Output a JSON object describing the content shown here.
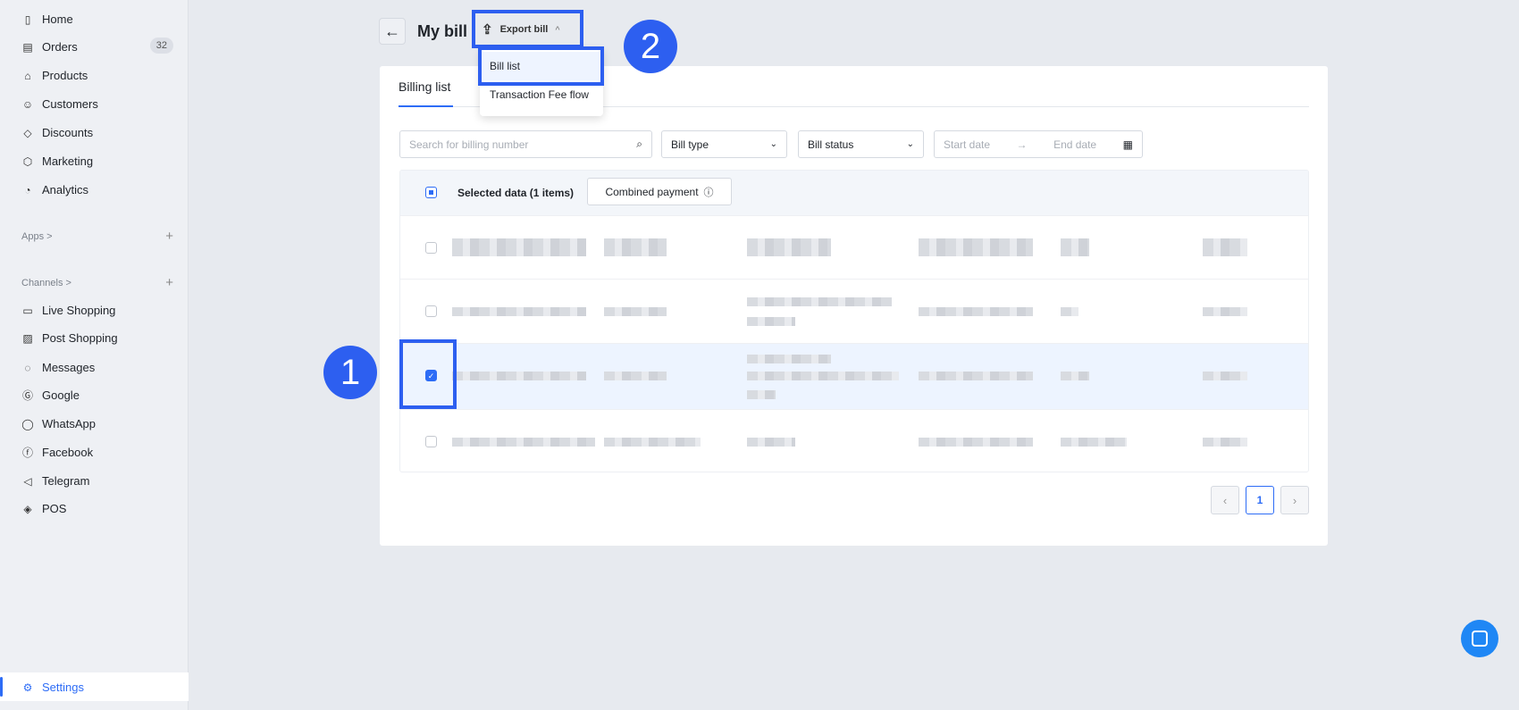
{
  "sidebar": {
    "items": [
      {
        "label": "Home",
        "icon": "home-icon"
      },
      {
        "label": "Orders",
        "icon": "orders-icon",
        "badge": "32"
      },
      {
        "label": "Products",
        "icon": "products-icon"
      },
      {
        "label": "Customers",
        "icon": "customers-icon"
      },
      {
        "label": "Discounts",
        "icon": "discounts-icon"
      },
      {
        "label": "Marketing",
        "icon": "marketing-icon"
      },
      {
        "label": "Analytics",
        "icon": "analytics-icon"
      }
    ],
    "apps_label": "Apps >",
    "channels_label": "Channels >",
    "channels": [
      {
        "label": "Live Shopping"
      },
      {
        "label": "Post Shopping"
      },
      {
        "label": "Messages"
      },
      {
        "label": "Google"
      },
      {
        "label": "WhatsApp"
      },
      {
        "label": "Facebook"
      },
      {
        "label": "Telegram"
      },
      {
        "label": "POS"
      }
    ],
    "settings_label": "Settings"
  },
  "header": {
    "title": "My bill",
    "export_label": "Export bill"
  },
  "export_menu": [
    "Bill list",
    "Transaction Fee flow"
  ],
  "annotations": [
    "1",
    "2"
  ],
  "tabs": [
    "Billing list"
  ],
  "filters": {
    "search_placeholder": "Search for billing number",
    "bill_type": "Bill type",
    "bill_status": "Bill status",
    "start_date": "Start date",
    "end_date": "End date"
  },
  "table": {
    "selected_text": "Selected data (1 items)",
    "combined_payment": "Combined payment",
    "row_count": 4,
    "checked_row": 3
  },
  "pagination": {
    "current": "1"
  },
  "colors": {
    "accent": "#2d5ff0",
    "link": "#2d6cf6"
  }
}
